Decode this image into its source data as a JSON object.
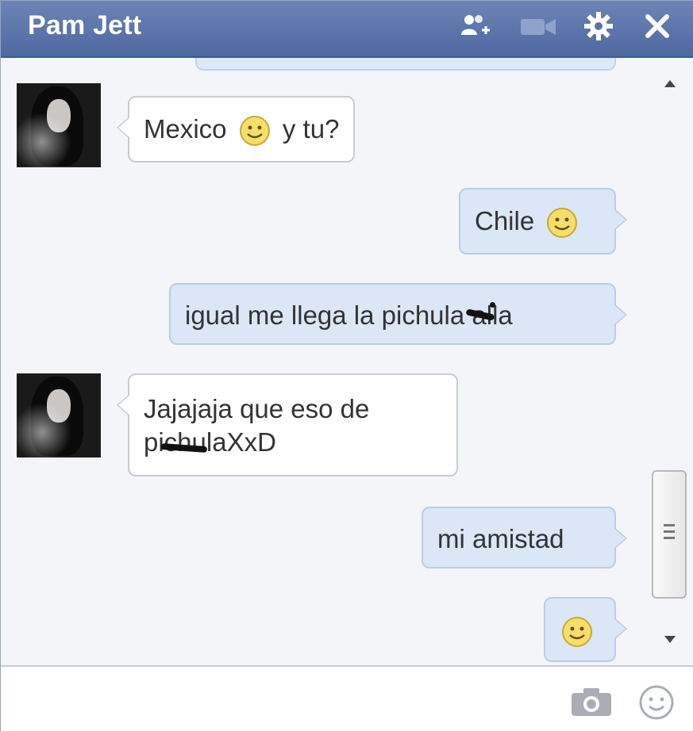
{
  "window": {
    "title": "Pam Jett",
    "header_icons": [
      "add-friend-icon",
      "video-call-icon",
      "gear-icon",
      "close-icon"
    ]
  },
  "messages": [
    {
      "side": "in",
      "text_before": "Mexico",
      "emoji": "smiley",
      "text_after": "y tu?"
    },
    {
      "side": "out",
      "text_before": "Chile",
      "emoji": "smiley",
      "text_after": ""
    },
    {
      "side": "out",
      "text": "igual me llega la pichula alla"
    },
    {
      "side": "in",
      "line1": "Jajajaja que eso de",
      "line2": "pichulaXxD"
    },
    {
      "side": "out",
      "text": "mi amistad"
    },
    {
      "side": "out",
      "emoji_only": "smiley"
    }
  ],
  "composer": {
    "value": "",
    "icons": [
      "camera-icon",
      "emoji-icon"
    ]
  },
  "colors": {
    "header": "#4e69a2",
    "outgoing_bubble": "#dbe7f6",
    "incoming_bubble": "#ffffff"
  }
}
